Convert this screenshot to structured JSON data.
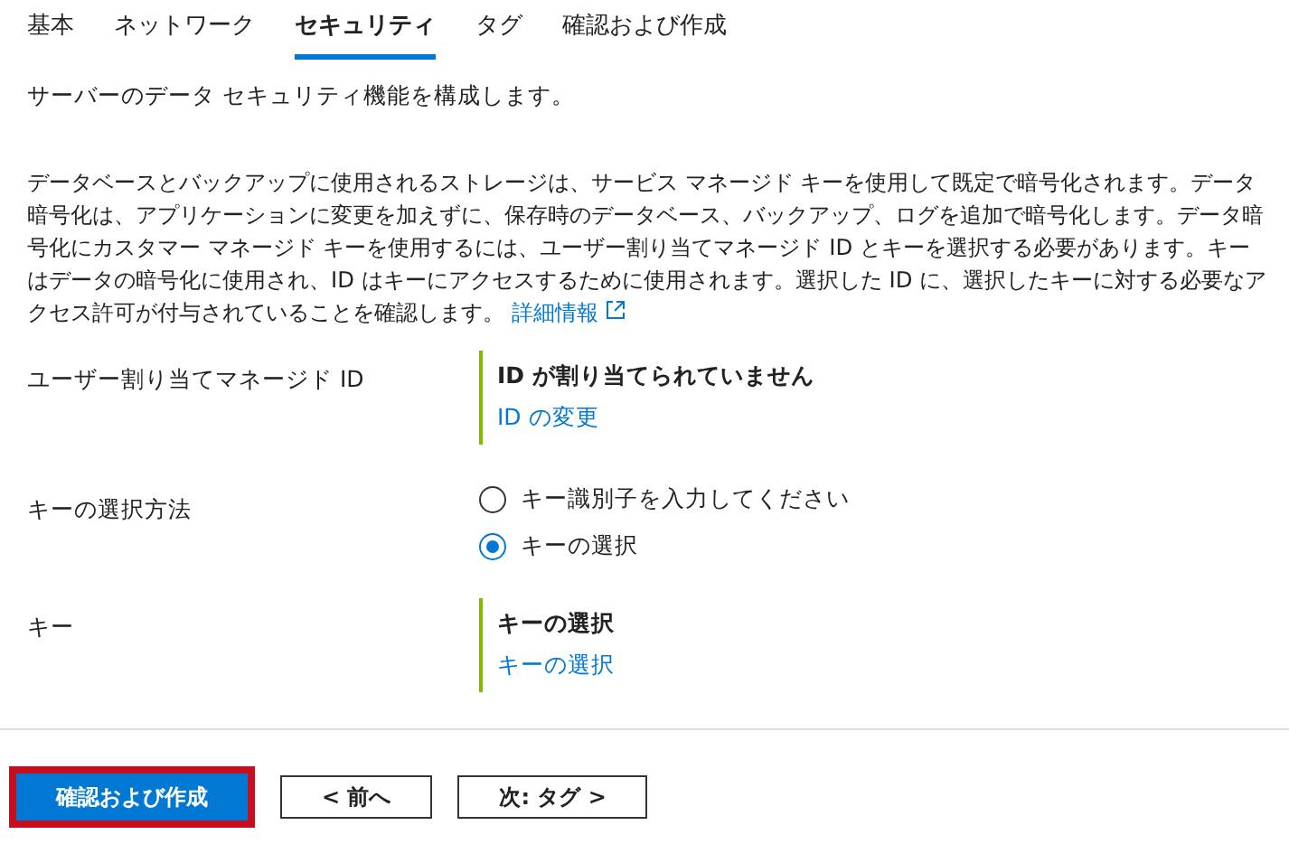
{
  "tabs": [
    {
      "label": "基本",
      "selected": false
    },
    {
      "label": "ネットワーク",
      "selected": false
    },
    {
      "label": "セキュリティ",
      "selected": true
    },
    {
      "label": "タグ",
      "selected": false
    },
    {
      "label": "確認および作成",
      "selected": false
    }
  ],
  "intro": "サーバーのデータ セキュリティ機能を構成します。",
  "description": {
    "text": "データベースとバックアップに使用されるストレージは、サービス マネージド キーを使用して既定で暗号化されます。データ暗号化は、アプリケーションに変更を加えずに、保存時のデータベース、バックアップ、ログを追加で暗号化します。データ暗号化にカスタマー マネージド キーを使用するには、ユーザー割り当てマネージド ID とキーを選択する必要があります。キーはデータの暗号化に使用され、ID はキーにアクセスするために使用されます。選択した ID に、選択したキーに対する必要なアクセス許可が付与されていることを確認します。",
    "link": "詳細情報"
  },
  "fields": [
    {
      "kind": "info",
      "label": "ユーザー割り当てマネージド ID",
      "value": "ID が割り当てられていません",
      "link": "ID の変更"
    },
    {
      "kind": "radio",
      "label": "キーの選択方法",
      "options": [
        {
          "label": "キー識別子を入力してください",
          "selected": false
        },
        {
          "label": "キーの選択",
          "selected": true
        }
      ]
    },
    {
      "kind": "info",
      "label": "キー",
      "value": "キーの選択",
      "link": "キーの選択"
    }
  ],
  "buttons": [
    {
      "label": "確認および作成",
      "kind": "primary",
      "highlighted": true
    },
    {
      "label": "< 前へ",
      "kind": "secondary",
      "highlighted": false
    },
    {
      "label": "次: タグ >",
      "kind": "secondary",
      "highlighted": false
    }
  ]
}
